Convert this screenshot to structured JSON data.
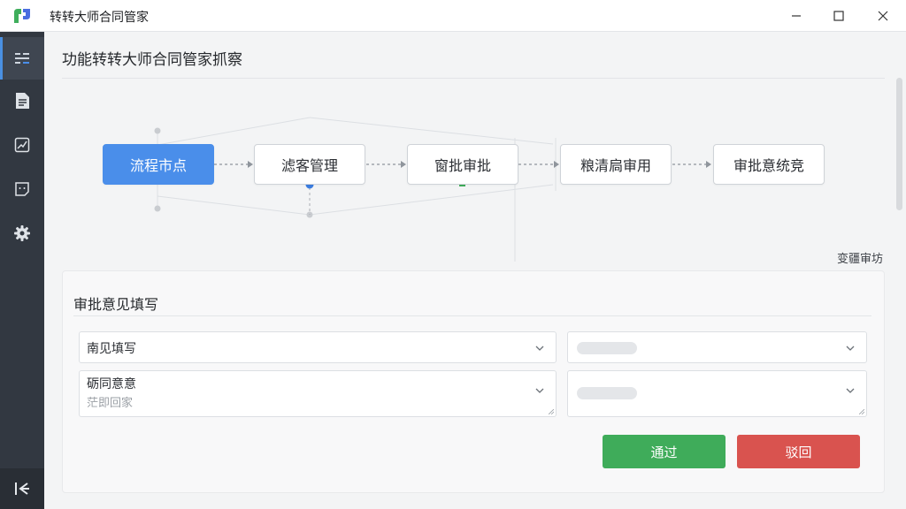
{
  "window": {
    "title": "转转大师合同管家",
    "minimize_icon": "minimize-icon",
    "maximize_icon": "maximize-icon",
    "close_icon": "close-icon"
  },
  "sidebar": {
    "items": [
      {
        "icon": "list-icon",
        "active": true
      },
      {
        "icon": "document-icon",
        "active": false
      },
      {
        "icon": "chart-icon",
        "active": false
      },
      {
        "icon": "note-icon",
        "active": false
      },
      {
        "icon": "gear-icon",
        "active": false
      }
    ],
    "bottom_icon": "collapse-icon"
  },
  "page": {
    "title": "功能转转大师合同管家抓察"
  },
  "flow": {
    "nodes": [
      "流程市点",
      "滤客管理",
      "窗批审批",
      "粮清扃审用",
      "审批意统竞"
    ],
    "active_index": 0,
    "link_label": "变疆审坊"
  },
  "form": {
    "title": "审批意见填写",
    "field1": {
      "value": "南见填写"
    },
    "field2": {
      "value": "砺同意意",
      "placeholder": "茫即回家"
    },
    "approve_label": "通过",
    "reject_label": "驳回"
  },
  "colors": {
    "accent": "#4a8eea",
    "sidebar": "#323841",
    "approve": "#3fac5a",
    "reject": "#d9534f"
  }
}
